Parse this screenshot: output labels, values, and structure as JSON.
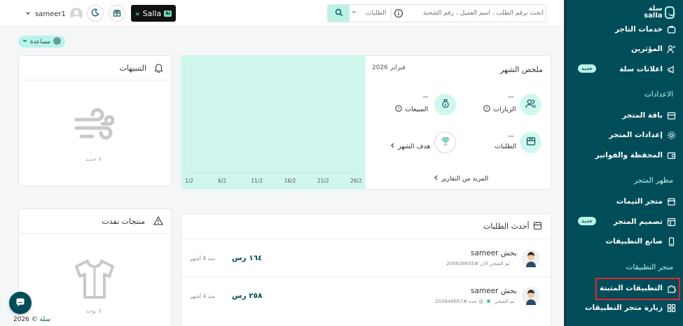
{
  "colors": {
    "sidebar_bg": "#004d5a",
    "accent": "#baf3e6",
    "chart_bg": "#d0f7ee",
    "highlight": "#e0272f"
  },
  "sidebar": {
    "logo_text": "سلة salla",
    "items": [
      {
        "label": "خدمات التاجر",
        "icon": "merchant-services-icon"
      },
      {
        "label": "المؤثرين",
        "icon": "influencers-icon"
      },
      {
        "label": "اعلانات سلة",
        "icon": "megaphone-icon",
        "badge": "جديد"
      },
      {
        "label": "باقة المتجر",
        "icon": "store-package-icon"
      },
      {
        "label": "إعدادات المتجر",
        "icon": "gear-icon"
      },
      {
        "label": "المحفظة والفواتير",
        "icon": "wallet-icon"
      },
      {
        "label": "متجر الثيمات",
        "icon": "themes-store-icon"
      },
      {
        "label": "تصميم المتجر",
        "icon": "layout-icon",
        "badge": "جديد"
      },
      {
        "label": "صانع التطبيقات",
        "icon": "mobile-icon"
      },
      {
        "label": "التطبيقات المثبتة",
        "icon": "puzzle-icon"
      },
      {
        "label": "زيارة متجر التطبيقات",
        "icon": "apps-grid-icon"
      }
    ],
    "sections": [
      "الاعدادات",
      "مظهر المتجر",
      "متجر التطبيقات"
    ]
  },
  "topbar": {
    "search_placeholder": "ابحث برقم الطلب ، اسم العميل ، رقم الشحنة",
    "search_scope": "الطلبات",
    "salla_label": "Salla",
    "salla_ai": "AI",
    "username": "sameer1"
  },
  "help": {
    "label": "مساعدة"
  },
  "notifications": {
    "title": "التنبيهات",
    "empty": "لا جديد"
  },
  "out_of_stock": {
    "title": "منتجات نفدت",
    "empty": "لا يوجد"
  },
  "summary": {
    "title": "ملخص الشهر",
    "period": "فبراير 2026",
    "visits_label": "الزيارات",
    "visits_value": "—",
    "sales_label": "المبيعات",
    "sales_value": "—",
    "orders_label": "الطلبات",
    "orders_value": "—",
    "goal_label": "هدف الشهر",
    "more_reports": "المزيد من التقارير"
  },
  "chart_data": {
    "type": "line",
    "categories": [
      "26/2",
      "21/2",
      "16/2",
      "11/2",
      "6/2",
      "1/2"
    ],
    "values": []
  },
  "latest_orders": {
    "title": "أحدث الطلبات",
    "rows": [
      {
        "name": "sameer بحش",
        "order_no": "#208639835",
        "status": "تم الشحن الان",
        "price": "١٦٤ رس",
        "time": "منذ 4 أشهر"
      },
      {
        "name": "sameer بحش",
        "order_no": "#203846657",
        "city": "@ جدة",
        "status": "تم الشحن",
        "price": "٢٥٨ رس",
        "time": "منذ 4 أشهر"
      }
    ]
  },
  "footer": {
    "copyright": "© 2026",
    "brand": "سلة"
  }
}
